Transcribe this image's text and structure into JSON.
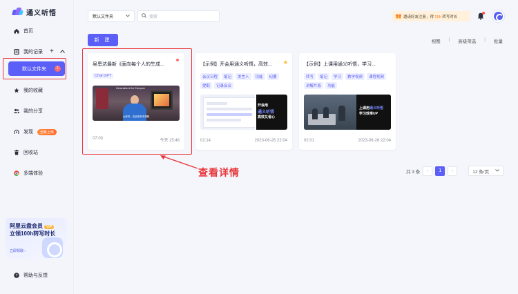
{
  "app": {
    "name": "通义听悟"
  },
  "sidebar": {
    "home": "首页",
    "my_records": "我的记录",
    "default_folder": "默认文件夹",
    "default_folder_badge": "1",
    "favorites": "我的收藏",
    "shares": "我的分享",
    "discover": "发现",
    "discover_tag": "全新上线",
    "trash": "回收站",
    "multi": "多端体验",
    "help": "帮助与反馈",
    "promo": {
      "line1": "阿里云盘会员",
      "vip": "VIP",
      "line2": "立领100h转写时长",
      "cta": "立即领取 ›"
    }
  },
  "topbar": {
    "folder_select": "默认文件夹",
    "search_placeholder": "搜索",
    "gift_text_a": "邀请好友注册，得 ",
    "gift_text_hl": "20h",
    "gift_text_b": " 转写时长"
  },
  "toolbar": {
    "new_button": "新 建",
    "view_links": [
      "视图",
      "高级筛选",
      "批量"
    ]
  },
  "cards": [
    {
      "title": "吴恩达最新《面向每个人的生成...",
      "tags": [
        "Chat GPT"
      ],
      "duration": "07:03",
      "time": "今天 15:46",
      "thumb_caption": "Generative AI for Everyone",
      "thumb_sub": "大家好，欢迎来到本课程"
    },
    {
      "title": "【示例】开会用通义听悟，高效...",
      "tags": [
        "会议日程",
        "笔记",
        "发言人",
        "功能",
        "纪要",
        "提取",
        "记录会议"
      ],
      "duration": "02:14",
      "time": "2023-06-26 22:04",
      "thumb_l1": "开会用",
      "thumb_l2": "通义听悟",
      "thumb_l3": "高效又省心"
    },
    {
      "title": "【示例】上课用通义听悟，学习...",
      "tags": [
        "转写",
        "笔记",
        "学习",
        "教学视频",
        "课程视频",
        "讲解片段",
        "功能"
      ],
      "duration": "02:01",
      "time": "2023-06-26 22:04",
      "thumb_l1a": "上课用",
      "thumb_l1b": "通义听悟",
      "thumb_l2": "学习效率UP"
    }
  ],
  "pagination": {
    "total": "共 3 条",
    "current": "1",
    "page_size": "12 条/页"
  },
  "annotation": "查看详情",
  "colors": {
    "accent": "#5b5ef7",
    "highlight_box": "#e8363b",
    "promo_tag": "#ff7a1a"
  }
}
